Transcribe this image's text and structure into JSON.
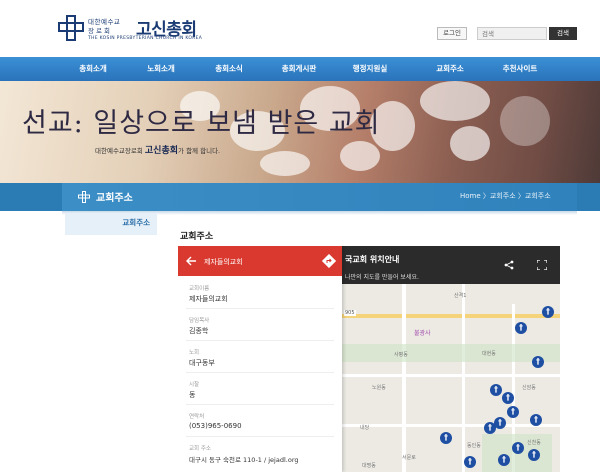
{
  "logo": {
    "line1": "대한예수교",
    "line2": "장로회",
    "name": "고신총회",
    "eng": "THE KOSIN PRESBYTERIAN CHURCH IN KOREA"
  },
  "header": {
    "login_label": "로그인",
    "search_placeholder": "검색",
    "search_button": "검색"
  },
  "nav": {
    "items": [
      {
        "label": "총회소개"
      },
      {
        "label": "노회소개"
      },
      {
        "label": "총회소식"
      },
      {
        "label": "총회게시판"
      },
      {
        "label": "행정지원실"
      },
      {
        "label": "교회주소"
      },
      {
        "label": "추천사이트"
      }
    ]
  },
  "banner": {
    "title": "선교: 일상으로 보냄 받은 교회",
    "subtitle_pre": "대한예수교장로회 ",
    "subtitle_brand": "고신총회",
    "subtitle_post": "가 함께 합니다."
  },
  "page": {
    "title": "교회주소",
    "breadcrumb": "Home 〉교회주소 〉교회주소",
    "side_item": "교회주소",
    "section_title": "교회주소"
  },
  "map": {
    "title": "국교회 위치안내",
    "hint": "나만의 지도를 만들어 보세요.",
    "places": {
      "temple": "불광사",
      "p1": "산격1",
      "p2": "사평동",
      "p3": "노원동",
      "p4": "대현동",
      "p5": "내당",
      "p6": "신암동",
      "p7": "서문로",
      "p8": "동인동",
      "p9": "대명동",
      "p10": "신천동",
      "road_num": "905"
    }
  },
  "info": {
    "head_name": "제자들의교회",
    "fields": [
      {
        "label": "교회이름",
        "value": "제자들의교회"
      },
      {
        "label": "담임목사",
        "value": "김종학"
      },
      {
        "label": "노회",
        "value": "대구동부"
      },
      {
        "label": "시찰",
        "value": "동"
      },
      {
        "label": "연락처",
        "value": "(053)965-0690"
      },
      {
        "label": "교회 주소",
        "value": "대구시 동구 숙천로 110-1 / jejadl.org"
      }
    ]
  },
  "colors": {
    "nav": "#2a73bb",
    "title_bar": "#2b7bb4",
    "info_head": "#d9392e",
    "pin": "#1f4fa3"
  }
}
